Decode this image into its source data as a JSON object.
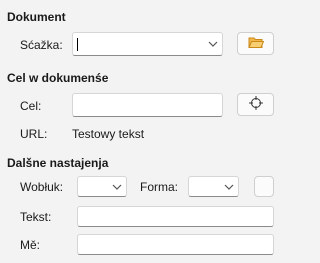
{
  "document_section": {
    "heading": "Dokument",
    "path_label": "Sćažka:",
    "path_value": ""
  },
  "target_section": {
    "heading": "Cel w dokumenśe",
    "target_label": "Cel:",
    "target_value": "",
    "url_label": "URL:",
    "url_value": "Testowy tekst"
  },
  "further_section": {
    "heading": "Dalšne nastajenja",
    "frame_label": "Wobłuk:",
    "frame_value": "",
    "form_label": "Forma:",
    "form_value": "",
    "text_label": "Tekst:",
    "text_value": "",
    "name_label": "Mě:",
    "name_value": ""
  },
  "icons": {
    "folder": "folder-open-icon",
    "target": "target-crosshair-icon",
    "dropdown": "chevron-down-icon"
  },
  "colors": {
    "background": "#f3f3f3",
    "folder": "#f2b84b"
  }
}
